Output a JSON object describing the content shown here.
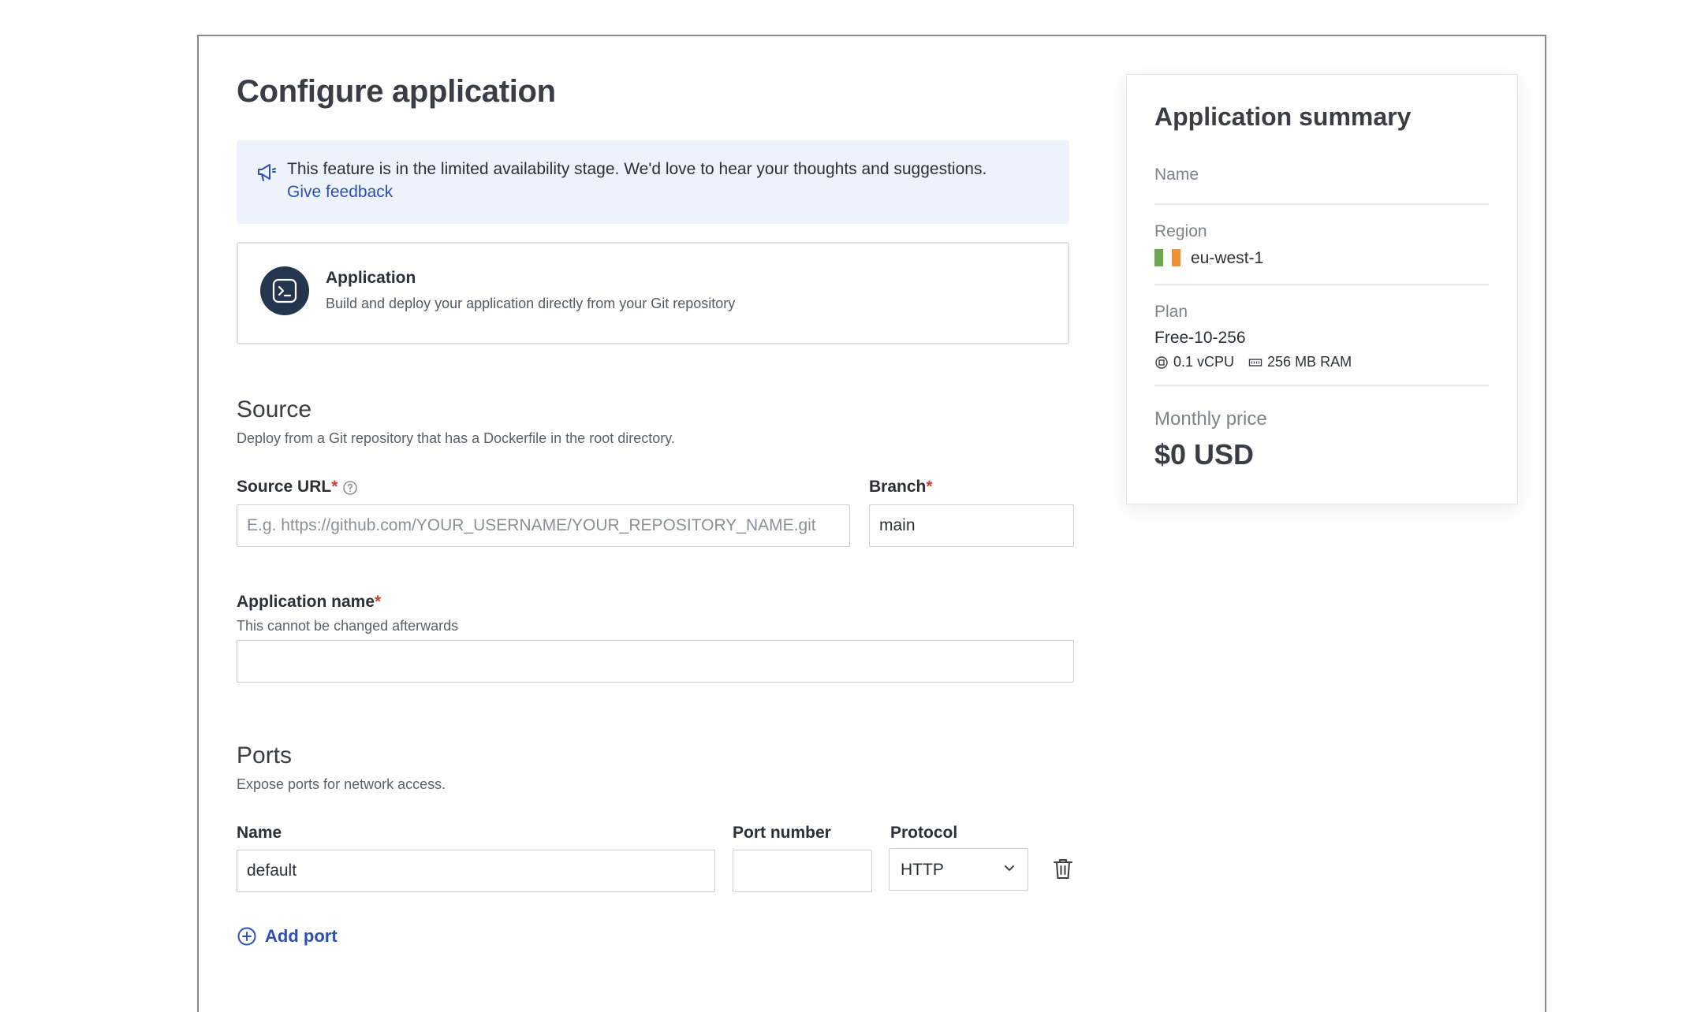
{
  "page": {
    "title": "Configure application"
  },
  "banner": {
    "icon": "megaphone-icon",
    "text": "This feature is in the limited availability stage. We'd love to hear your thoughts and suggestions.",
    "link": "Give feedback"
  },
  "app_type": {
    "icon": "terminal-icon",
    "title": "Application",
    "description": "Build and deploy your application directly from your Git repository"
  },
  "source": {
    "title": "Source",
    "subtitle": "Deploy from a Git repository that has a Dockerfile in the root directory.",
    "url_label": "Source URL",
    "url_placeholder": "E.g. https://github.com/YOUR_USERNAME/YOUR_REPOSITORY_NAME.git",
    "url_value": "",
    "branch_label": "Branch",
    "branch_value": "main",
    "required_mark": "*"
  },
  "app_name": {
    "label": "Application name",
    "hint": "This cannot be changed afterwards",
    "value": ""
  },
  "ports": {
    "title": "Ports",
    "subtitle": "Expose ports for network access.",
    "name_label": "Name",
    "port_label": "Port number",
    "protocol_label": "Protocol",
    "rows": [
      {
        "name": "default",
        "port": "",
        "protocol": "HTTP"
      }
    ],
    "add_label": "Add port"
  },
  "summary": {
    "title": "Application summary",
    "name_label": "Name",
    "name_value": "",
    "region_label": "Region",
    "region_value": "eu-west-1",
    "region_flag_colors": [
      "#6aa84f",
      "#ffffff",
      "#f0913a"
    ],
    "plan_label": "Plan",
    "plan_value": "Free-10-256",
    "cpu": "0.1 vCPU",
    "ram": "256 MB RAM",
    "price_label": "Monthly price",
    "price_value": "$0 USD"
  },
  "colors": {
    "accent": "#2d4fb3",
    "required": "#d23a3a",
    "banner_bg": "#eef3fb",
    "app_icon_bg": "#26354e"
  }
}
